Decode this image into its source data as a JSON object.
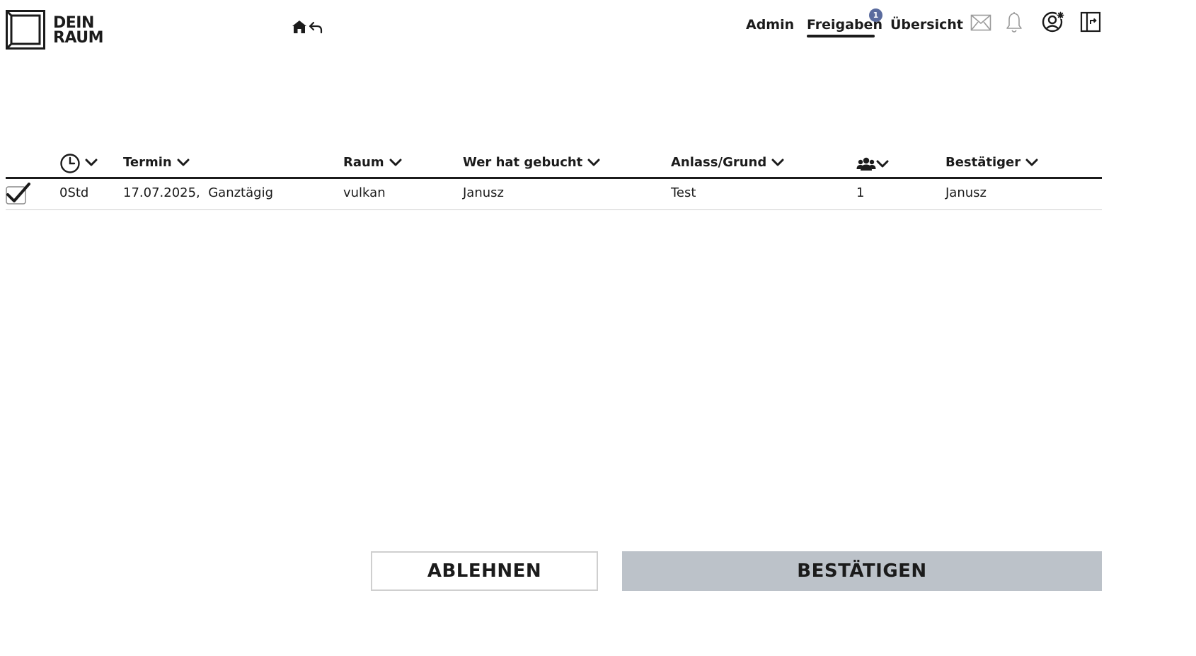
{
  "brand": {
    "logo_line1": "DEIN",
    "logo_line2": "RAUM"
  },
  "nav": {
    "items": [
      {
        "label": "Admin"
      },
      {
        "label": "Freigaben",
        "active": true,
        "badge": "1"
      },
      {
        "label": "Übersicht"
      }
    ],
    "icons": [
      "home-icon",
      "back-arrow-icon",
      "mail-icon",
      "bell-icon",
      "profile-icon",
      "logout-icon"
    ],
    "badge_color": "#5a6b9e"
  },
  "table": {
    "columns": [
      {
        "key": "duration",
        "label": "",
        "icon": "clock-icon"
      },
      {
        "key": "termin",
        "label": "Termin"
      },
      {
        "key": "raum",
        "label": "Raum"
      },
      {
        "key": "gebucht",
        "label": "Wer hat gebucht"
      },
      {
        "key": "anlass",
        "label": "Anlass/Grund"
      },
      {
        "key": "personen",
        "label": "",
        "icon": "people-icon"
      },
      {
        "key": "bestaetiger",
        "label": "Bestätiger"
      }
    ],
    "rows": [
      {
        "checked": true,
        "duration": "0Std",
        "termin": "17.07.2025,  Ganztägig",
        "raum": "vulkan",
        "gebucht": "Janusz",
        "anlass": "Test",
        "personen": "1",
        "bestaetiger": "Janusz"
      }
    ]
  },
  "actions": {
    "reject_label": "ABLEHNEN",
    "confirm_label": "BESTÄTIGEN",
    "confirm_color": "#bcc2c9"
  }
}
